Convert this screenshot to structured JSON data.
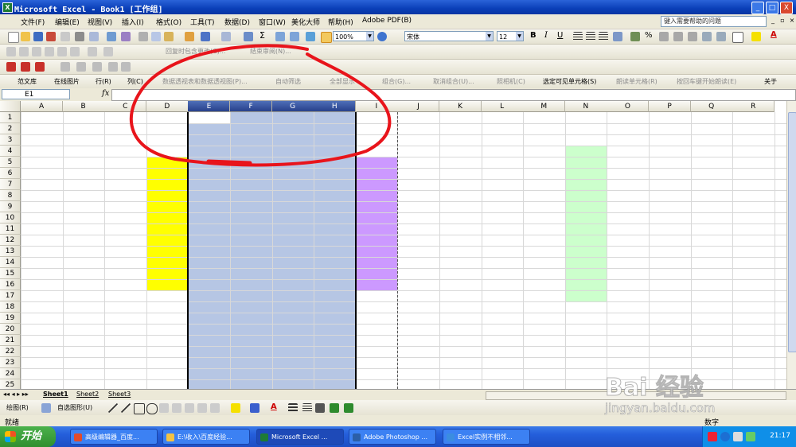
{
  "window": {
    "title": "Microsoft Excel - Book1  [工作组]",
    "buttons": [
      "_",
      "□",
      "X"
    ]
  },
  "menu": {
    "items": [
      "文件(F)",
      "编辑(E)",
      "视图(V)",
      "插入(I)",
      "格式(O)",
      "工具(T)",
      "数据(D)",
      "窗口(W)",
      "美化大师",
      "帮助(H)",
      "Adobe PDF(B)"
    ],
    "help_placeholder": "键入需要帮助的问题"
  },
  "toolbar_standard": {
    "zoom": "100%",
    "font": "宋体",
    "font_size": "12",
    "bold": "B",
    "italic": "I",
    "underline": "U",
    "percent": "%"
  },
  "toolbar_review": {
    "reply_changes": "回复时包含更改(C)...",
    "end_review": "结束审阅(N)..."
  },
  "toolbar_addin": {
    "items": [
      "范文库",
      "在线图片",
      "行(R)",
      "列(C)",
      "数据透视表和数据透视图(P)...",
      "自动筛选",
      "全部显示",
      "组合(G)...",
      "取消组合(U)...",
      "照相机(C)",
      "选定可见单元格(S)",
      "朗读单元格(R)",
      "按回车键开始朗读(E)",
      "关于"
    ]
  },
  "formula_bar": {
    "name_box": "E1",
    "fx": "fx",
    "content": ""
  },
  "grid": {
    "columns": [
      "A",
      "B",
      "C",
      "D",
      "E",
      "F",
      "G",
      "H",
      "I",
      "J",
      "K",
      "L",
      "M",
      "N",
      "O",
      "P",
      "Q",
      "R"
    ],
    "rows": [
      "1",
      "2",
      "3",
      "4",
      "5",
      "6",
      "7",
      "8",
      "9",
      "10",
      "11",
      "12",
      "13",
      "14",
      "15",
      "16",
      "17",
      "18",
      "19",
      "20",
      "21",
      "22",
      "23",
      "24",
      "25"
    ],
    "selected_columns": [
      "E",
      "F",
      "G",
      "H"
    ],
    "fill_colors": {
      "yellow": "#ffff00",
      "purple": "#cc99ff",
      "green": "#ccffcc",
      "selection": "#b6c6e4"
    }
  },
  "sheet_tabs": [
    "Sheet1",
    "Sheet2",
    "Sheet3"
  ],
  "drawing_toolbar": {
    "draw": "绘图(R)",
    "autoshapes": "自选图形(U)"
  },
  "status": {
    "ready": "就绪",
    "mode": "数字"
  },
  "taskbar": {
    "start": "开始",
    "tasks": [
      {
        "label": "高级编辑器_百度...",
        "color": "#e24b2b"
      },
      {
        "label": "E:\\收入\\百度经验...",
        "color": "#f3c243"
      },
      {
        "label": "Microsoft Excel ...",
        "color": "#1e7b34"
      },
      {
        "label": "Adobe Photoshop ...",
        "color": "#2b5fa8"
      },
      {
        "label": "Excel实例不相邻...",
        "color": "#3b8de0"
      }
    ],
    "clock": "21:17"
  },
  "watermark": {
    "brand": "Bai 经验",
    "url": "jingyan.baidu.com"
  },
  "annotation_color": "#e8141b"
}
